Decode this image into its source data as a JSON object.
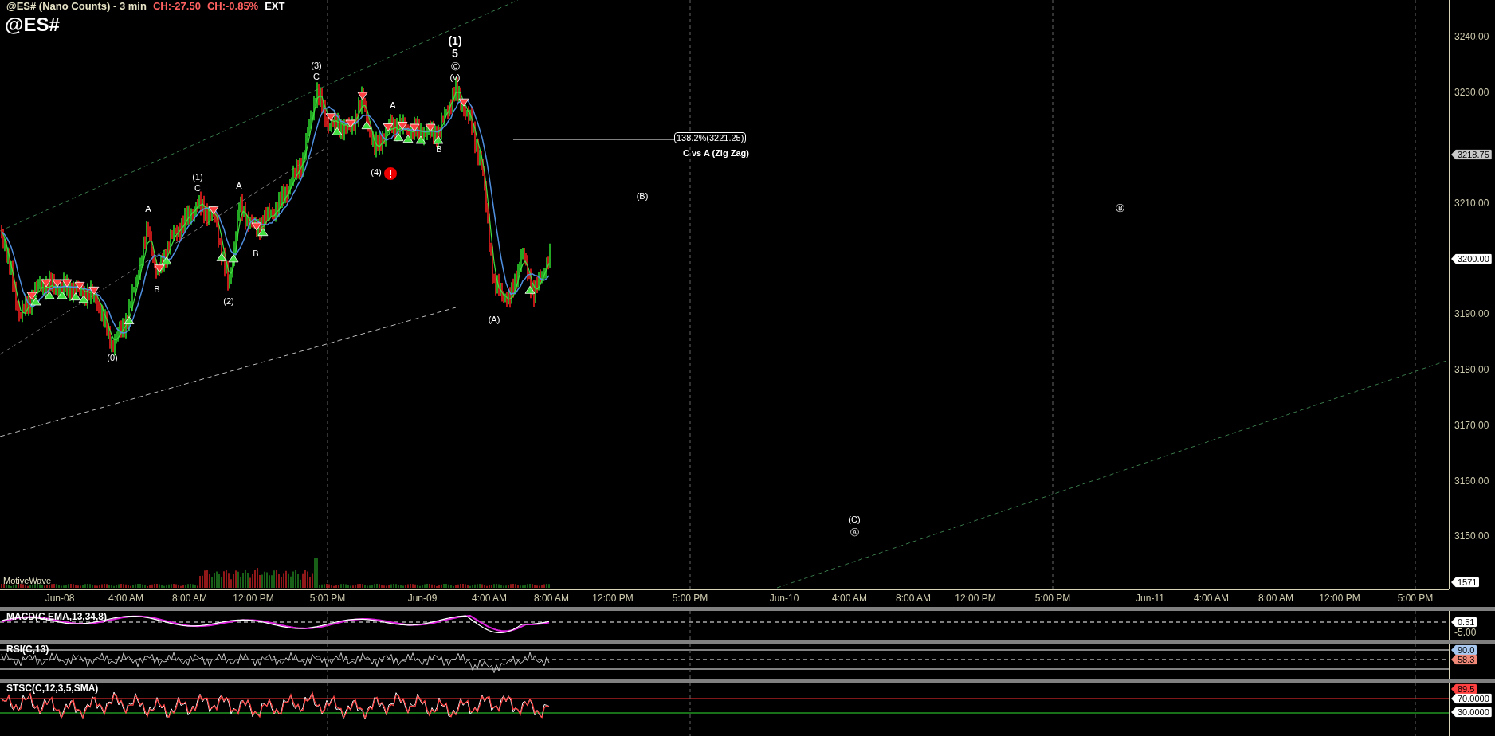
{
  "header": {
    "title": "@ES# (Nano Counts) - 3 min",
    "change": "CH:-27.50",
    "change_percent": "CH:-0.85%",
    "session": "EXT",
    "symbol": "@ES#"
  },
  "wave_labels": [
    {
      "text": "(1)",
      "kind": "bold"
    },
    {
      "text": "5",
      "kind": "bold"
    },
    {
      "text": "Ⓒ",
      "kind": "plain"
    },
    {
      "text": "(v)",
      "kind": "plain"
    },
    {
      "text": "(3)",
      "kind": "plain"
    },
    {
      "text": "C",
      "kind": "plain"
    },
    {
      "text": "A",
      "kind": "plain"
    },
    {
      "text": "B",
      "kind": "plain"
    },
    {
      "text": "(4)",
      "kind": "plain"
    },
    {
      "text": "A",
      "kind": "plain"
    },
    {
      "text": "B",
      "kind": "plain"
    },
    {
      "text": "(1)",
      "kind": "plain"
    },
    {
      "text": "C",
      "kind": "plain"
    },
    {
      "text": "A",
      "kind": "plain"
    },
    {
      "text": "B",
      "kind": "plain"
    },
    {
      "text": "(2)",
      "kind": "plain"
    },
    {
      "text": "(0)",
      "kind": "plain"
    },
    {
      "text": "(A)",
      "kind": "plain"
    },
    {
      "text": "(B)",
      "kind": "plain"
    },
    {
      "text": "Ⓑ",
      "kind": "plain"
    },
    {
      "text": "(C)",
      "kind": "plain"
    },
    {
      "text": "Ⓐ",
      "kind": "plain"
    }
  ],
  "fib": {
    "value": "138.2%(3221.25)",
    "caption": "C vs A (Zig Zag)"
  },
  "volume_label": "MotiveWave",
  "price_axis": {
    "ticks": [
      "3240.00",
      "3230.00",
      "3210.00",
      "3190.00",
      "3180.00",
      "3170.00",
      "3160.00",
      "3150.00"
    ],
    "markers": [
      {
        "label": "3218.75",
        "color": "#c8c8c8"
      },
      {
        "label": "3200.00",
        "color": "#ffffff"
      },
      {
        "label": "1571",
        "color": "#ffffff"
      }
    ]
  },
  "time_axis": [
    "Jun-08",
    "4:00 AM",
    "8:00 AM",
    "12:00 PM",
    "5:00 PM",
    "Jun-09",
    "4:00 AM",
    "8:00 AM",
    "12:00 PM",
    "5:00 PM",
    "Jun-10",
    "4:00 AM",
    "8:00 AM",
    "12:00 PM",
    "5:00 PM",
    "Jun-11",
    "4:00 AM",
    "8:00 AM",
    "12:00 PM",
    "5:00 PM"
  ],
  "indicators": [
    {
      "kind": "macd",
      "title": "MACD(C,EMA,13,34,8)",
      "ticks": [
        "-5.00"
      ],
      "markers": [
        {
          "label": "0.51",
          "color": "#ffffff"
        }
      ]
    },
    {
      "kind": "rsi",
      "title": "RSI(C,13)",
      "markers": [
        {
          "label": "90.0",
          "color": "#a8c8f0"
        },
        {
          "label": "58.3",
          "color": "#f08878"
        }
      ]
    },
    {
      "kind": "stsc",
      "title": "STSC(C,12,3,5,SMA)",
      "markers": [
        {
          "label": "89.5",
          "color": "#ff4040"
        },
        {
          "label": "70.0000",
          "color": "#ffffff"
        },
        {
          "label": "30.0000",
          "color": "#ffffff"
        }
      ]
    }
  ]
}
